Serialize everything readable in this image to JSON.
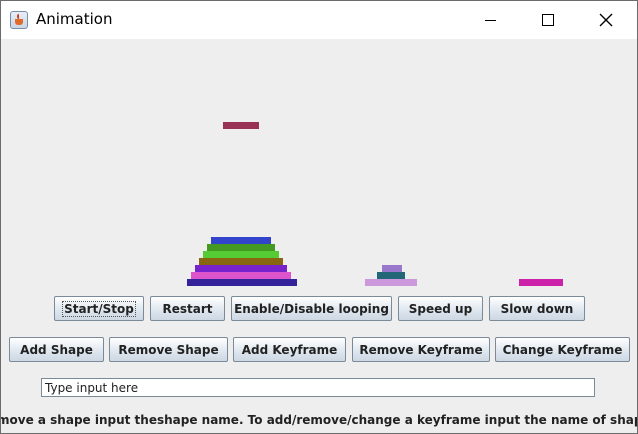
{
  "window": {
    "title": "Animation",
    "icon": "java-coffee-cup-icon"
  },
  "controls": {
    "minimize_icon": "minimize-icon",
    "maximize_icon": "maximize-icon",
    "close_icon": "close-icon"
  },
  "shapes": [
    {
      "color": "#993355"
    },
    {
      "color": "#3344cc"
    },
    {
      "color": "#449922"
    },
    {
      "color": "#55cc33"
    },
    {
      "color": "#886611"
    },
    {
      "color": "#7722cc"
    },
    {
      "color": "#dd55cc"
    },
    {
      "color": "#332299"
    },
    {
      "color": "#9977cc"
    },
    {
      "color": "#226677"
    },
    {
      "color": "#cc99dd"
    },
    {
      "color": "#cc22aa"
    }
  ],
  "playback": {
    "start_stop": "Start/Stop",
    "restart": "Restart",
    "looping": "Enable/Disable looping",
    "speed_up": "Speed up",
    "slow_down": "Slow down"
  },
  "editing": {
    "add_shape": "Add Shape",
    "remove_shape": "Remove Shape",
    "add_keyframe": "Add Keyframe",
    "remove_keyframe": "Remove Keyframe",
    "change_keyframe": "Change Keyframe"
  },
  "input": {
    "value": "Type input here"
  },
  "status": {
    "text": "move a shape input theshape name. To add/remove/change a keyframe input the name of shape, time, x position"
  }
}
